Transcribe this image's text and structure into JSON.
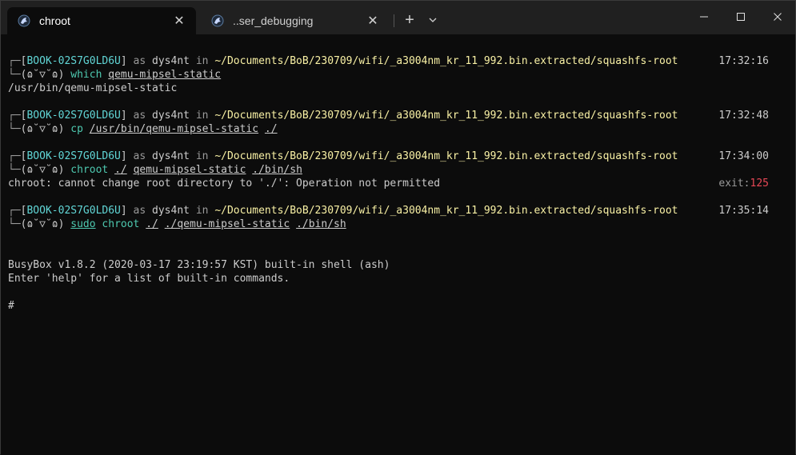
{
  "tabs": [
    {
      "label": "chroot",
      "close": "✕",
      "active": true
    },
    {
      "label": "..ser_debugging",
      "close": "✕",
      "active": false
    }
  ],
  "tabbar": {
    "new_tab": "+",
    "dropdown": "⌄"
  },
  "window_controls": {
    "minimize": "—",
    "maximize": "☐",
    "close": "✕"
  },
  "prompt": {
    "corner_top": "┌─",
    "corner_bottom": "└─",
    "host_open": "[",
    "host": "BOOK-02S7G0LD6U",
    "host_close": "]",
    "as": "as",
    "user": "dys4nt",
    "in": "in",
    "path": "~/Documents/BoB/230709/wifi/_a3004nm_kr_11_992.bin.extracted/squashfs-root",
    "face": "(ɷ˘▽˘ɷ)"
  },
  "blocks": [
    {
      "time": "17:32:16",
      "cmd": "which",
      "args": [
        "qemu-mipsel-static"
      ],
      "output": "/usr/bin/qemu-mipsel-static"
    },
    {
      "time": "17:32:48",
      "cmd": "cp",
      "args": [
        "/usr/bin/qemu-mipsel-static",
        "./"
      ]
    },
    {
      "time": "17:34:00",
      "cmd": "chroot",
      "args": [
        "./",
        "qemu-mipsel-static",
        "./bin/sh"
      ],
      "output": "chroot: cannot change root directory to './': Operation not permitted",
      "exit_label": "exit:",
      "exit_code": "125"
    },
    {
      "time": "17:35:14",
      "sudo": "sudo",
      "cmd": "chroot",
      "args": [
        "./",
        "./qemu-mipsel-static",
        "./bin/sh"
      ]
    }
  ],
  "busybox": {
    "line1": "BusyBox v1.8.2 (2020-03-17 23:19:57 KST) built-in shell (ash)",
    "line2": "Enter 'help' for a list of built-in commands.",
    "prompt": "#"
  },
  "colors": {
    "bg": "#0c0c0c",
    "host": "#61d6d6",
    "path": "#f9f1a5",
    "cmd": "#4ec9b0",
    "error": "#e74856"
  }
}
